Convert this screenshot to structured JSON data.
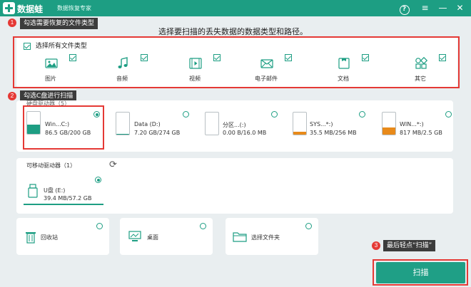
{
  "titlebar": {
    "app_name": "数据蛙",
    "subtitle": "数据恢复专家",
    "help_glyph": "?",
    "menu_glyph": "≡",
    "minimize_glyph": "—",
    "close_glyph": "✕"
  },
  "main_title": "选择要扫描的丢失数据的数据类型和路径。",
  "annotations": {
    "step1": {
      "num": "1",
      "text": "勾选需要恢复的文件类型"
    },
    "step2": {
      "num": "2",
      "text": "勾选C盘进行扫描"
    },
    "step3": {
      "num": "3",
      "text": "最后轻点“扫描”"
    }
  },
  "file_types": {
    "select_all_label": "选择所有文件类型",
    "items": [
      {
        "label": "图片",
        "icon": "image-icon",
        "checked": true
      },
      {
        "label": "音频",
        "icon": "music-icon",
        "checked": true
      },
      {
        "label": "视频",
        "icon": "video-icon",
        "checked": true
      },
      {
        "label": "电子邮件",
        "icon": "mail-icon",
        "checked": true
      },
      {
        "label": "文档",
        "icon": "document-icon",
        "checked": true
      },
      {
        "label": "其它",
        "icon": "other-icon",
        "checked": true
      }
    ]
  },
  "hard_drives": {
    "section_label": "硬盘驱动器（5）",
    "items": [
      {
        "name": "Win...C:)",
        "size": "86.5 GB/200 GB",
        "used_fraction": 0.43,
        "color": "#1d9e83",
        "selected": true
      },
      {
        "name": "Data (D:)",
        "size": "7.20 GB/274 GB",
        "used_fraction": 0.03,
        "color": "#1d9e83",
        "selected": false
      },
      {
        "name": "分区...(:)",
        "size": "0.00  B/16.0 MB",
        "used_fraction": 0.0,
        "color": "#e88a1a",
        "selected": false
      },
      {
        "name": "SYS...*:)",
        "size": "35.5 MB/256 MB",
        "used_fraction": 0.14,
        "color": "#e88a1a",
        "selected": false
      },
      {
        "name": "WIN...*:)",
        "size": "817 MB/2.5 GB",
        "used_fraction": 0.32,
        "color": "#e88a1a",
        "selected": false
      }
    ]
  },
  "removable": {
    "section_label": "可移动驱动器（1）",
    "refresh_glyph": "⟳",
    "items": [
      {
        "name": "U盘 (E:)",
        "size": "39.4 MB/57.2 GB",
        "selected": true
      }
    ]
  },
  "locations": {
    "items": [
      {
        "label": "回收站",
        "icon": "recycle-bin-icon"
      },
      {
        "label": "桌面",
        "icon": "desktop-icon"
      },
      {
        "label": "选择文件夹",
        "icon": "folder-icon"
      }
    ]
  },
  "scan_button": "扫描",
  "colors": {
    "accent": "#1d9e83",
    "annotation_red": "#e53935",
    "partition_orange": "#e88a1a"
  }
}
